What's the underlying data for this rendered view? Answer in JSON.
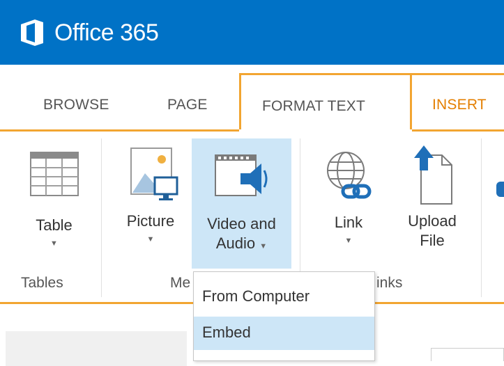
{
  "brand": {
    "title": "Office 365",
    "color": "#0072c6"
  },
  "tabs": [
    {
      "label": "BROWSE"
    },
    {
      "label": "PAGE"
    },
    {
      "label": "FORMAT TEXT"
    },
    {
      "label": "INSERT"
    }
  ],
  "ribbon": {
    "buttons": {
      "table": {
        "label": "Table",
        "icon": "table-icon"
      },
      "picture": {
        "label": "Picture",
        "icon": "picture-icon"
      },
      "video_audio": {
        "label_line1": "Video and",
        "label_line2": "Audio",
        "icon": "video-audio-icon"
      },
      "link": {
        "label": "Link",
        "icon": "link-icon"
      },
      "upload_file": {
        "label_line1": "Upload",
        "label_line2": "File",
        "icon": "upload-file-icon"
      }
    },
    "groups": {
      "tables": "Tables",
      "media": "Me",
      "links": "inks"
    }
  },
  "dropdown": {
    "items": [
      {
        "label": "From Computer"
      },
      {
        "label": "Embed"
      }
    ]
  },
  "colors": {
    "accent": "#f2a531",
    "insert_text": "#e47f00",
    "hover": "#cde6f7"
  }
}
